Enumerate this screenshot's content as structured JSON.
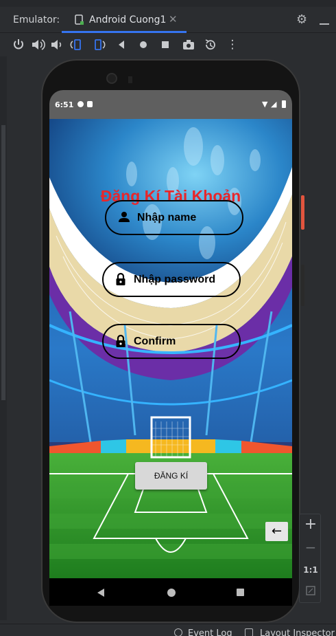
{
  "ide": {
    "tool_window_label": "Emulator:",
    "device_tab": "Android Cuong1",
    "tab_close": "✕",
    "bottom": {
      "event_log": "Event Log",
      "layout_inspector": "Layout Inspector"
    }
  },
  "device": {
    "status_time": "6:51"
  },
  "app": {
    "title": "Đăng Kí Tài Khoản",
    "name_placeholder": "Nhập name",
    "password_placeholder": "Nhập password",
    "confirm_placeholder": "Confirm",
    "register_button": "ĐĂNG KÍ",
    "title_color": "#e8262a"
  },
  "zoom": {
    "zoom_in": "+",
    "zoom_out": "−",
    "actual_size": "1:1"
  },
  "icons": {
    "back_arrow": "←"
  }
}
